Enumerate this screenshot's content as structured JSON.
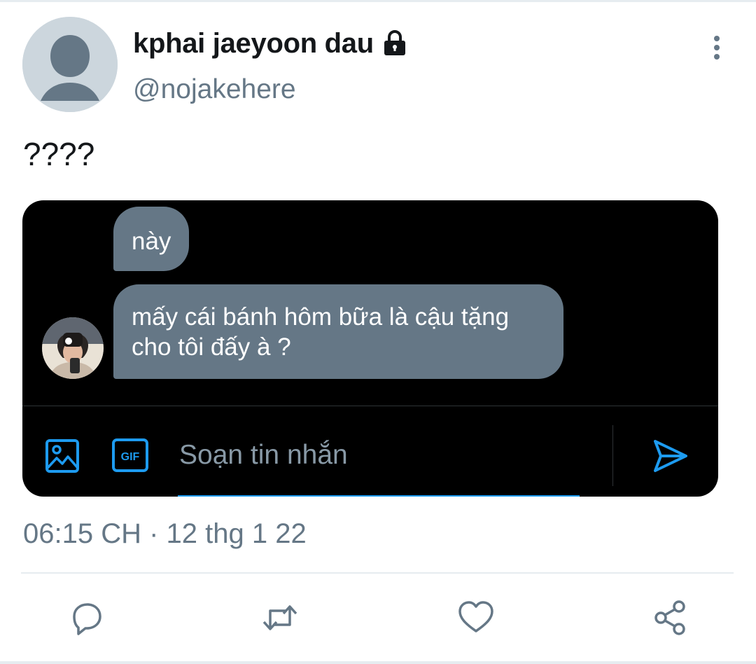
{
  "author": {
    "display_name": "kphai jaeyoon dau",
    "handle": "@nojakehere",
    "protected_icon": "lock-icon",
    "avatar": "default-avatar"
  },
  "tweet": {
    "text": "????",
    "timestamp": "06:15 CH · 12 thg 1 22"
  },
  "dm_screenshot": {
    "messages": [
      {
        "text": "này"
      },
      {
        "text": "mấy cái bánh hôm bữa là cậu tặng cho tôi đấy à ?"
      }
    ],
    "composer": {
      "placeholder": "Soạn tin nhắn",
      "media_icon": "image-icon",
      "gif_icon": "gif-icon",
      "send_icon": "send-icon"
    }
  },
  "actions": [
    "reply-icon",
    "retweet-icon",
    "like-icon",
    "share-icon"
  ],
  "colors": {
    "accent": "#1d9bf0",
    "secondary_text": "#657786",
    "bubble": "#657786"
  }
}
